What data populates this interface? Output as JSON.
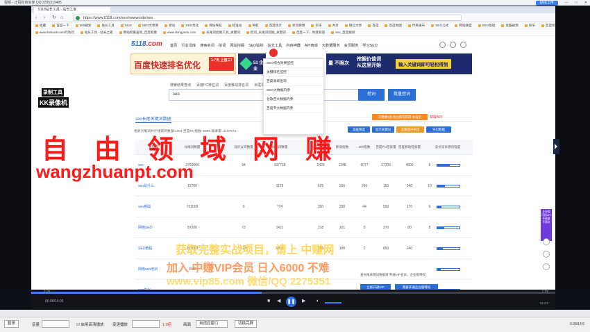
{
  "player": {
    "title": "视频 - 正码财商尚家 QQ 2295313485",
    "upload_label": "贴线上传",
    "speed_left": "1.0x",
    "speed_right": "1.0x",
    "current_time": "06:09/14:05",
    "version": "v3.4.0",
    "progress": 0.44
  },
  "browser": {
    "tabs": [
      "5118站长工具 - 站长之家"
    ],
    "url": "https://www.5118.com/seo/newwords/seo",
    "bookmarks_row1": [
      "收藏",
      "百度一下",
      "360搜索",
      "站长工具",
      "5118",
      "SEO文章库",
      "新站",
      "SEO优化",
      "网站导航",
      "标准站",
      "导航",
      "百度统计",
      "新浪微博",
      "京东",
      "共享",
      "微信文章",
      "百度",
      "百度地图",
      "传奇发布",
      "SEO公式",
      "网站联盟",
      "SEO基础",
      "优酷视频",
      "知乎",
      "百度统计"
    ],
    "bookmarks_row2": [
      "www.hekuo8.com的访问",
      "站长工具 - 站长之家",
      "网站权重查询_百度权重",
      "www.dongyedu.com",
      "长尾词挖掘工具_关键词",
      "挖词_长尾词挖掘_关键词",
      "百度一下，你就知道",
      "seo_百度搜索"
    ]
  },
  "site": {
    "logo_text": "5118",
    "logo_suffix": ".com",
    "nav": [
      "首页",
      "行业词库",
      "搜索名词",
      "挖词",
      "网站挖掘",
      "SEO监控",
      "站长工具",
      "内容神器",
      "API商城",
      "大数据服务",
      "会员服务",
      "学习SEO"
    ],
    "banner1_text": "百度快速排名优化",
    "banner1_sub": "1-7天 上首三!",
    "banner2_text": "51 企业",
    "banner3_text": "量 不限次",
    "banner4_line1": "挖掘价值词",
    "banner4_line2": "从这里开始",
    "banner4_cta": "输入关键词即可轻松得到",
    "dropdown": [
      "SEO综合效果监控",
      "关键排名监控",
      "百度收录查询",
      "SEO大数据内参",
      "谷歌百大数据内参",
      "百度专大数据内参"
    ],
    "search_tabs": [
      "搜索结果查询",
      "百度PC排名词",
      "百度移动排名词",
      "长尾词挖掘",
      "相关词"
    ],
    "search_value": "seo",
    "search_button": "挖词",
    "bulk_button": "批量挖词",
    "section_title": "seo长尾关键词数据",
    "tag_button": "只需要5条评价即可获得",
    "tag_vip": "会员价",
    "api_label": "获取API",
    "stats_text": "相关长尾词共计搜索到数量:1081 百度PC指数: 5995 收录量: 2107572",
    "actions": [
      "高级筛选",
      "显示关键词",
      "全部选中导出",
      "导出数据"
    ],
    "headers": [
      "关键词",
      "长尾词数量",
      "竞价公司数量",
      "长尾词数量",
      "百度指数",
      "移动指数",
      "360指数",
      "百度PC检索量",
      "百度移动检索量",
      "竞价竞争激烈程度"
    ],
    "rows": [
      {
        "kw": "seo",
        "c1": "2760000",
        "c2": "94",
        "c3": "107718",
        "c4": "2429",
        "c5": "1348",
        "c6": "6077",
        "c7": "17200",
        "c8": "4600",
        "c9": "5",
        "level": 0.55
      },
      {
        "kw": "seo是什么",
        "c1": "12700",
        "c2": "",
        "c3": "1126",
        "c4": "625",
        "c5": "556",
        "c6": "266",
        "c7": "150",
        "c8": "540",
        "c9": "10",
        "level": 0.35
      },
      {
        "kw": "seo基础",
        "c1": "731000",
        "c2": "0",
        "c3": "774",
        "c4": "350",
        "c5": "290",
        "c6": "44",
        "c7": "550",
        "c8": "170",
        "c9": "6",
        "level": 0.2
      },
      {
        "kw": "网络SEO",
        "c1": "87200",
        "c2": "73",
        "c3": "1421",
        "c4": "318",
        "c5": "101",
        "c6": "0",
        "c7": "370",
        "c8": "80",
        "c9": "8",
        "level": 0.3
      },
      {
        "kw": "SEO教程",
        "c1": "307000",
        "c2": "123",
        "c3": "1859",
        "c4": "295",
        "c5": "180",
        "c6": "2",
        "c7": "650",
        "c8": "240",
        "c9": "",
        "level": 0.25
      },
      {
        "kw": "网络seo培训",
        "c1": "1500",
        "c2": "",
        "c3": "",
        "c4": "",
        "c5": "",
        "c6": "",
        "c7": "",
        "c8": "",
        "c9": "",
        "level": 0.15
      },
      {
        "kw": "seo优化",
        "c1": "",
        "c2": "",
        "c3": "",
        "c4": "",
        "c5": "",
        "c6": "",
        "c7": "",
        "c8": "",
        "c9": "",
        "level": 0.1
      }
    ],
    "popup_text": "查长尾关键词数据请 开通VIP会员，企业版特权",
    "popup_btn1": "立即开通VIP",
    "popup_btn2": "我要开通企业版特权",
    "float_text": "企业版 可用API 不限量 不限次"
  },
  "watermark": {
    "cn": "自由领域网赚",
    "url": "wangzhuanpt.com",
    "line1": "获取完整实战项目，请上 中赚网",
    "line2": "加入 中赚VIP会员 日入6000 不难",
    "line3": "www.vip85.com 微信/QQ 2275351",
    "kk1": "录制工具",
    "kk2": "KK录像机"
  },
  "statusbar": {
    "pause": "暂停",
    "volume": "音量",
    "hq": "启用高清播放",
    "speed": "变速播放",
    "speed_val": "1.0倍",
    "ratio": "画面",
    "ratio_val": "自适应窗口",
    "shortcut": "切换完屏",
    "time": "6:28/14:5"
  },
  "colors": {
    "accent": "#2b6fd6",
    "brand_red": "#e8322c",
    "watermark_red": "#ff1a1a"
  }
}
